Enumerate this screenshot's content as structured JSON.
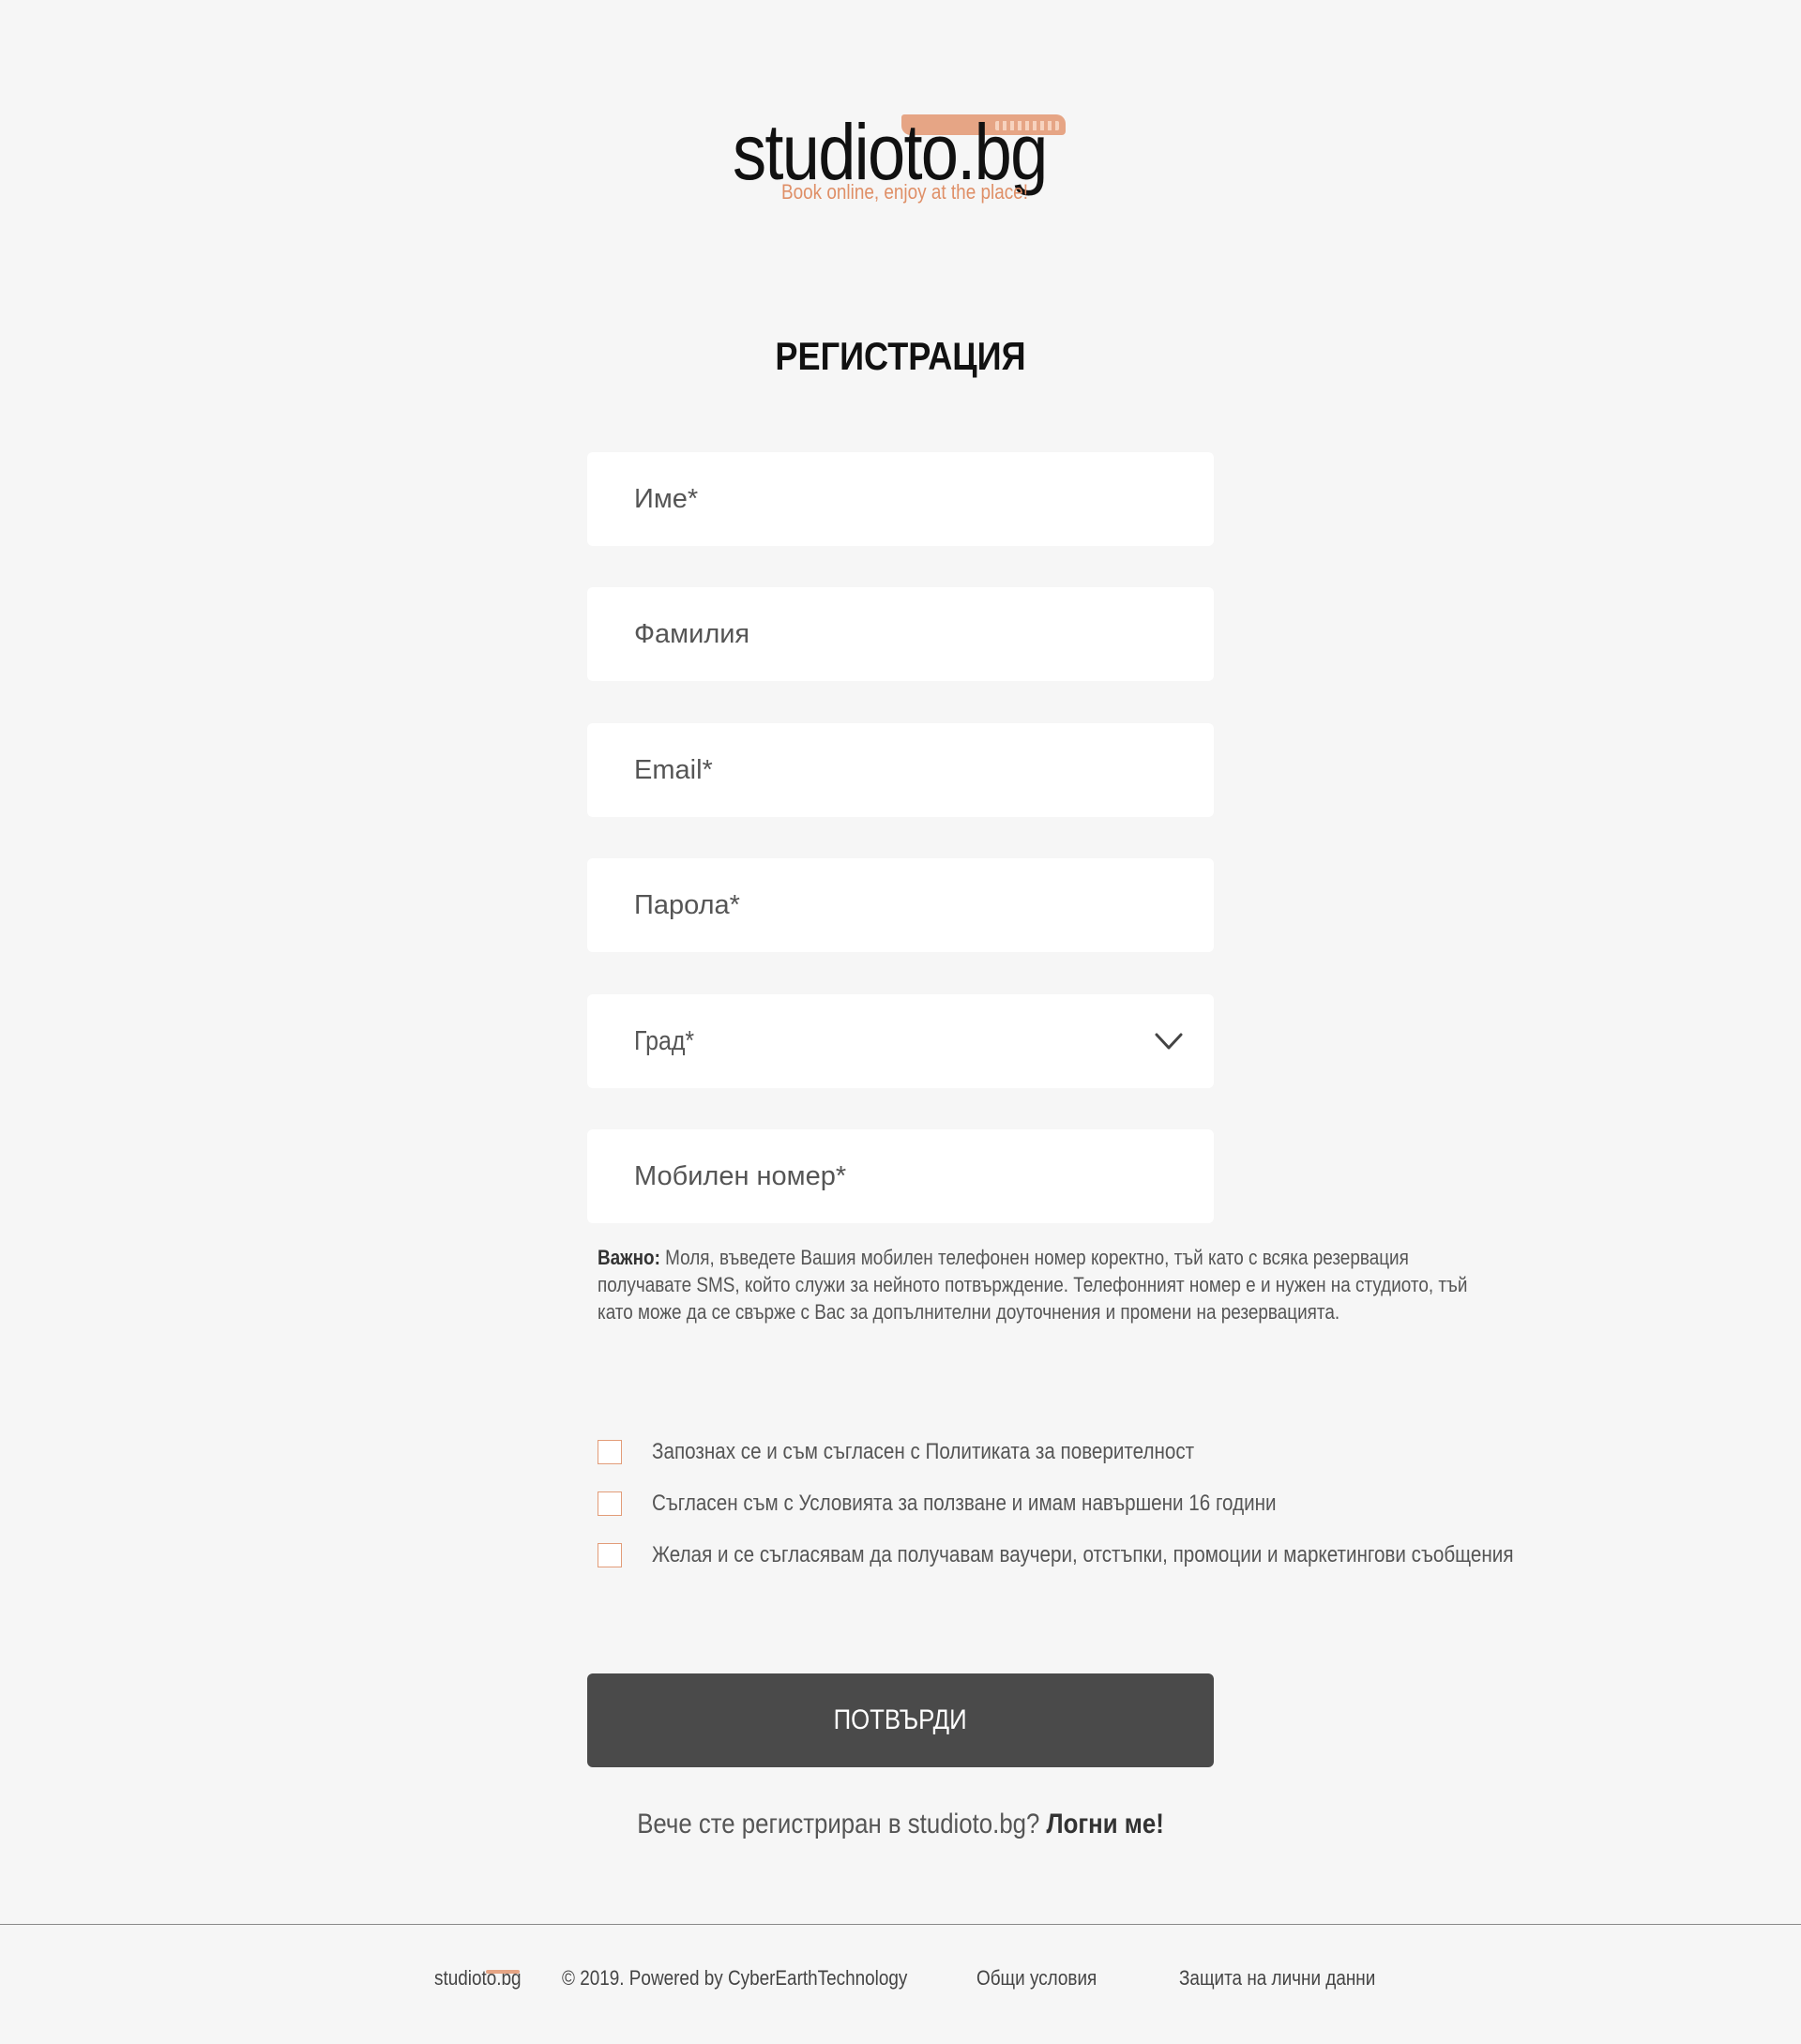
{
  "logo": {
    "wordmark": "studioto.bg",
    "tagline": "Book online, enjoy at the place!"
  },
  "heading": "РЕГИСТРАЦИЯ",
  "fields": {
    "first_name": "Име*",
    "last_name": "Фамилия",
    "email": "Email*",
    "password": "Парола*",
    "city": "Град*",
    "mobile": "Мобилен номер*"
  },
  "note": {
    "label": "Важно:",
    "text": "Моля, въведете Вашия мобилен телефонен номер коректно, тъй като с всяка резервация получавате SMS, който служи за нейното потвърждение. Телефонният номер е и нужен на студиото, тъй като може да се свърже с Вас за допълнителни доуточнения и промени на резервацията."
  },
  "checkboxes": {
    "privacy": "Запознах се и съм съгласен с Политиката за поверителност",
    "terms": "Съгласен съм с Условията за ползване и имам навършени 16 години",
    "marketing": "Желая и се съгласявам да получавам ваучери, отстъпки, промоции и маркетингови съобщения"
  },
  "submit_label": "ПОТВЪРДИ",
  "login_prompt": {
    "text": "Вече сте регистриран в studioto.bg?",
    "link": "Логни ме!"
  },
  "footer": {
    "brand": "studioto.bg",
    "copyright": "© 2019. Powered by CyberEarthTechnology",
    "terms_link": "Общи условия",
    "privacy_link": "Защита на лични данни"
  },
  "colors": {
    "accent": "#e6a585",
    "button": "#4a4a4a",
    "background": "#f6f6f6"
  },
  "icons": {
    "city_dropdown": "chevron-down-icon"
  }
}
